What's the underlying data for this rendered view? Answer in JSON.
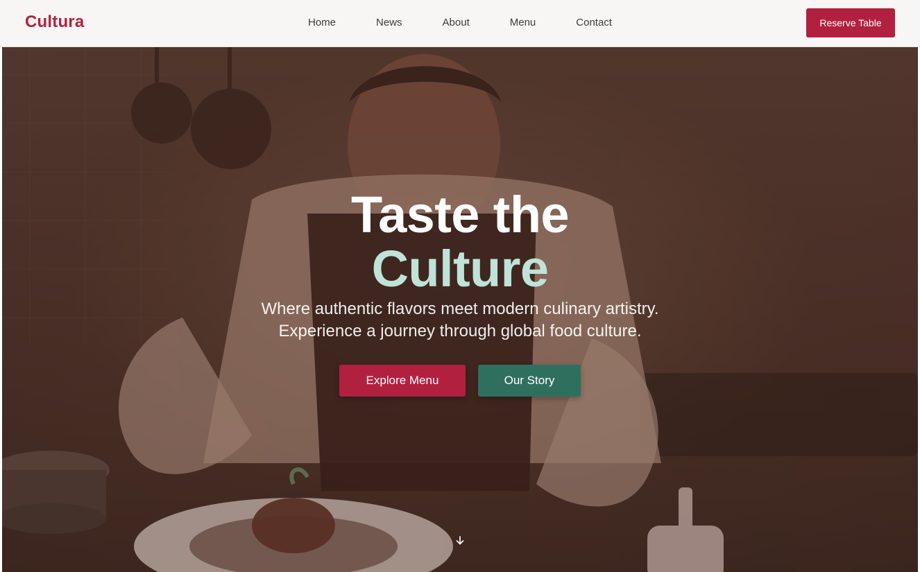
{
  "colors": {
    "brand": "#b2203f",
    "accent_mint": "#bfe3d7",
    "button_primary": "#b2203f",
    "button_secondary": "#2f6f5e",
    "nav_bg": "#f7f6f4"
  },
  "nav": {
    "brand": "Cultura",
    "links": [
      "Home",
      "News",
      "About",
      "Menu",
      "Contact"
    ],
    "cta": "Reserve Table"
  },
  "hero": {
    "title_line1": "Taste the",
    "title_line2": "Culture",
    "subtitle_line1": "Where authentic flavors meet modern culinary artistry.",
    "subtitle_line2": "Experience a journey through global food culture.",
    "buttons": {
      "primary": "Explore Menu",
      "secondary": "Our Story"
    },
    "scroll_icon": "arrow-down-icon"
  }
}
